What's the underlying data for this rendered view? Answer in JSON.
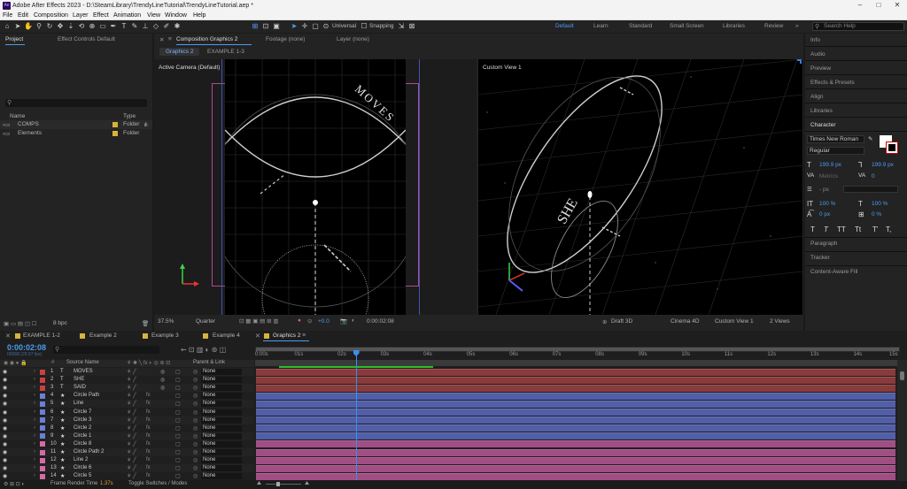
{
  "titlebar": {
    "title": "Adobe After Effects 2023 - D:\\SteamLibrary\\TrendyLineTutorial\\TrendyLineTutorial.aep *",
    "app_badge": "Ae"
  },
  "menu": [
    "File",
    "Edit",
    "Composition",
    "Layer",
    "Effect",
    "Animation",
    "View",
    "Window",
    "Help"
  ],
  "toolbar": {
    "universal": "Universal",
    "snapping": "Snapping"
  },
  "workspaces": [
    "Default",
    "Learn",
    "Standard",
    "Small Screen",
    "Libraries",
    "Review"
  ],
  "search": {
    "placeholder": "Search Help"
  },
  "project": {
    "tab_project": "Project",
    "tab_effect_controls": "Effect Controls Default",
    "col_name": "Name",
    "col_type": "Type",
    "items": [
      {
        "name": "COMPS",
        "type": "Folder"
      },
      {
        "name": "Elements",
        "type": "Folder"
      }
    ],
    "bpc": "8 bpc"
  },
  "comp_panel": {
    "tab_composition": "Composition Graphics 2",
    "tab_footage": "Footage (none)",
    "tab_layer": "Layer (none)",
    "subtabs": [
      "Graphics 2",
      "EXAMPLE 1-3"
    ],
    "left_view_label": "Active Camera (Default)",
    "right_view_label": "Custom View 1",
    "left_text": "MOVES",
    "right_text": "SHE",
    "zoom": "37.5%",
    "resolution": "Quarter",
    "exposure": "+0.0",
    "timecode": "0:00:02:08",
    "draft3d": "Draft 3D",
    "renderer": "Cinema 4D",
    "view": "Custom View 1",
    "views": "2 Views"
  },
  "right_panels": {
    "items": [
      "Info",
      "Audio",
      "Preview",
      "Effects & Presets",
      "Align",
      "Libraries",
      "Character"
    ],
    "font": "Times New Roman",
    "style": "Regular",
    "size": "199.9 px",
    "leading": "199.9 px",
    "kerning": "Metrics",
    "tracking": "0",
    "stroke": "- px",
    "vscale": "100 %",
    "hscale": "100 %",
    "baseline": "0 px",
    "tsume": "0 %",
    "styles": [
      "T",
      "T",
      "TT",
      "Tt",
      "T'",
      "T,"
    ],
    "bottom_items": [
      "Paragraph",
      "Tracker",
      "Content-Aware Fill"
    ]
  },
  "timeline": {
    "tabs": [
      "EXAMPLE 1-2",
      "Example 2",
      "Example 3",
      "Example 4",
      "Graphics 2"
    ],
    "timecode": "0:00:02:08",
    "timecode_sub": "00068 (29.97 fps)",
    "col_source": "Source Name",
    "col_parent": "Parent & Link",
    "parent_none": "None",
    "ruler": [
      "0:00s",
      "01s",
      "02s",
      "03s",
      "04s",
      "05s",
      "06s",
      "07s",
      "08s",
      "09s",
      "10s",
      "11s",
      "12s",
      "13s",
      "14s",
      "15s"
    ],
    "playhead_fraction": 0.156,
    "layers": [
      {
        "num": "1",
        "type": "T",
        "name": "MOVES",
        "color": "#c94040"
      },
      {
        "num": "2",
        "type": "T",
        "name": "SHE",
        "color": "#c94040"
      },
      {
        "num": "3",
        "type": "T",
        "name": "SAID",
        "color": "#c94040"
      },
      {
        "num": "4",
        "type": "★",
        "name": "Circle Path",
        "color": "#6a7fd6"
      },
      {
        "num": "5",
        "type": "★",
        "name": "Line",
        "color": "#6a7fd6"
      },
      {
        "num": "6",
        "type": "★",
        "name": "Circle 7",
        "color": "#6a7fd6"
      },
      {
        "num": "7",
        "type": "★",
        "name": "Circle 3",
        "color": "#6a7fd6"
      },
      {
        "num": "8",
        "type": "★",
        "name": "Circle 2",
        "color": "#6a7fd6"
      },
      {
        "num": "9",
        "type": "★",
        "name": "Circle 1",
        "color": "#6a7fd6"
      },
      {
        "num": "10",
        "type": "★",
        "name": "Circle 8",
        "color": "#d66aa6"
      },
      {
        "num": "11",
        "type": "★",
        "name": "Circle Path 2",
        "color": "#d66aa6"
      },
      {
        "num": "12",
        "type": "★",
        "name": "Line 2",
        "color": "#d66aa6"
      },
      {
        "num": "13",
        "type": "★",
        "name": "Circle 6",
        "color": "#d66aa6"
      },
      {
        "num": "14",
        "type": "★",
        "name": "Circle 5",
        "color": "#d66aa6"
      }
    ],
    "frame_render_label": "Frame Render Time",
    "frame_render_value": "1.37s",
    "toggle_label": "Toggle Switches / Modes"
  },
  "colors": {
    "red_layer": "#8a3a3a",
    "blue_layer": "#515ea8",
    "pink_layer": "#a04e84",
    "accent": "#2d8ceb"
  }
}
